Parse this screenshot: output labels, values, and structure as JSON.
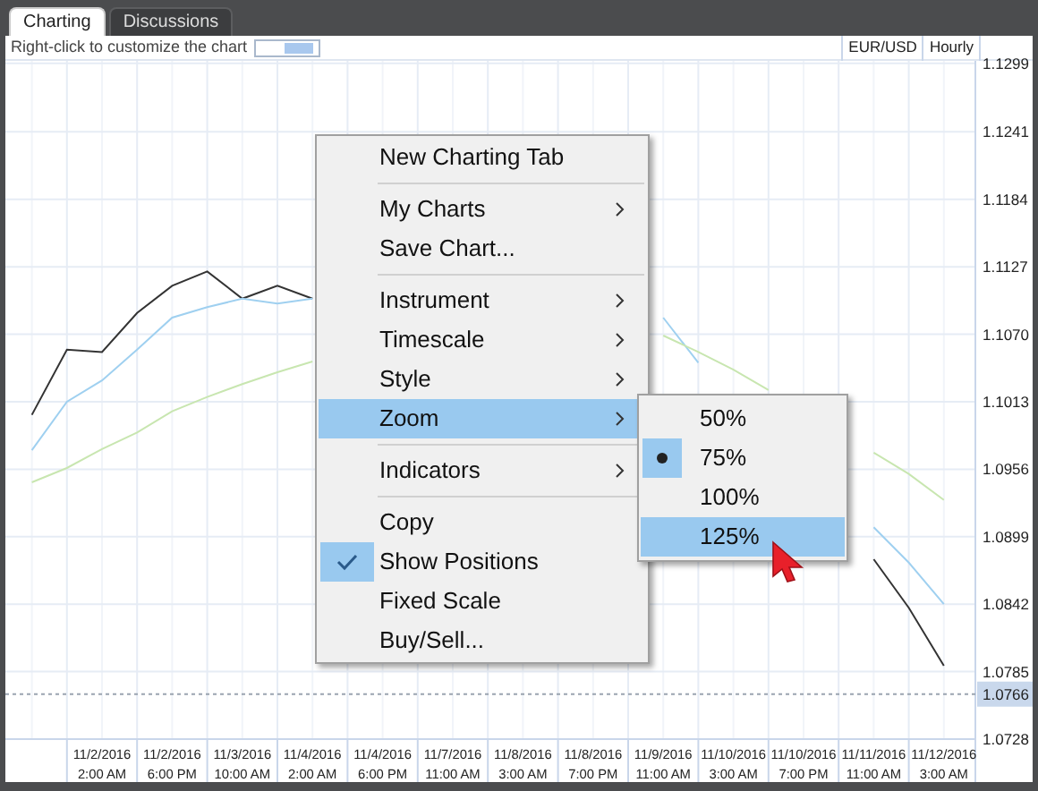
{
  "tabs": [
    {
      "label": "Charting",
      "selected": true
    },
    {
      "label": "Discussions",
      "selected": false
    }
  ],
  "toolbar": {
    "hint": "Right-click to customize the chart",
    "instrument": "EUR/USD",
    "timescale": "Hourly"
  },
  "chart": {
    "chart_data": {
      "type": "line",
      "grid": true,
      "categories": [
        null,
        null,
        "11/2/2016\n2:00 AM",
        null,
        "11/2/2016\n6:00 PM",
        null,
        "11/3/2016\n10:00 AM",
        null,
        "11/4/2016\n2:00 AM",
        null,
        "11/4/2016\n6:00 PM",
        null,
        "11/7/2016\n11:00 AM",
        null,
        "11/8/2016\n3:00 AM",
        null,
        "11/8/2016\n7:00 PM",
        null,
        "11/9/2016\n11:00 AM",
        null,
        "11/10/2016\n3:00 AM",
        null,
        "11/10/2016\n7:00 PM",
        null,
        "11/11/2016\n11:00 AM",
        null,
        "11/12/2016\n3:00 AM"
      ],
      "series": [
        {
          "color": "#333333",
          "values": [
            1.1002,
            1.1057,
            1.1055,
            1.1088,
            1.1111,
            1.1123,
            1.11,
            1.1111,
            1.11,
            null,
            null,
            null,
            null,
            null,
            null,
            null,
            null,
            null,
            null,
            null,
            null,
            null,
            null,
            null,
            1.088,
            1.0839,
            1.079
          ]
        },
        {
          "color": "#9fd0f0",
          "values": [
            1.0972,
            1.1013,
            1.1031,
            1.1057,
            1.1084,
            1.1093,
            1.11,
            1.1096,
            1.11,
            null,
            null,
            null,
            null,
            null,
            null,
            null,
            null,
            null,
            1.1084,
            1.1046,
            null,
            null,
            null,
            null,
            1.0907,
            1.0877,
            1.0842
          ]
        },
        {
          "color": "#c8e6b0",
          "values": [
            1.0945,
            1.0957,
            1.0973,
            1.0987,
            1.1005,
            1.1017,
            1.1028,
            1.1038,
            1.1047,
            null,
            null,
            null,
            null,
            null,
            null,
            null,
            null,
            null,
            1.1069,
            1.1055,
            1.104,
            1.1023,
            null,
            null,
            1.097,
            1.0952,
            1.093
          ]
        }
      ],
      "ylim": [
        1.0728,
        1.1301
      ],
      "yticks": [
        {
          "value": 1.1299,
          "label": "1.1299"
        },
        {
          "value": 1.1241,
          "label": "1.1241"
        },
        {
          "value": 1.1184,
          "label": "1.1184"
        },
        {
          "value": 1.1127,
          "label": "1.1127"
        },
        {
          "value": 1.107,
          "label": "1.1070"
        },
        {
          "value": 1.1013,
          "label": "1.1013"
        },
        {
          "value": 1.0956,
          "label": "1.0956"
        },
        {
          "value": 1.0899,
          "label": "1.0899"
        },
        {
          "value": 1.0842,
          "label": "1.0842"
        },
        {
          "value": 1.0785,
          "label": "1.0785"
        },
        {
          "value": 1.0728,
          "label": "1.0728"
        }
      ],
      "ref_lines": [
        {
          "axis": "y",
          "value": 1.0766,
          "label": "1.0766"
        }
      ]
    }
  },
  "context_menu": {
    "groups": [
      [
        {
          "label": "New Charting Tab",
          "submenu": false,
          "checked": false,
          "highlighted": false
        }
      ],
      [
        {
          "label": "My Charts",
          "submenu": true,
          "checked": false,
          "highlighted": false
        },
        {
          "label": "Save Chart...",
          "submenu": false,
          "checked": false,
          "highlighted": false
        }
      ],
      [
        {
          "label": "Instrument",
          "submenu": true,
          "checked": false,
          "highlighted": false
        },
        {
          "label": "Timescale",
          "submenu": true,
          "checked": false,
          "highlighted": false
        },
        {
          "label": "Style",
          "submenu": true,
          "checked": false,
          "highlighted": false
        },
        {
          "label": "Zoom",
          "submenu": true,
          "checked": false,
          "highlighted": true
        }
      ],
      [
        {
          "label": "Indicators",
          "submenu": true,
          "checked": false,
          "highlighted": false
        }
      ],
      [
        {
          "label": "Copy",
          "submenu": false,
          "checked": false,
          "highlighted": false
        },
        {
          "label": "Show Positions",
          "submenu": false,
          "checked": true,
          "highlighted": false
        },
        {
          "label": "Fixed Scale",
          "submenu": false,
          "checked": false,
          "highlighted": false
        },
        {
          "label": "Buy/Sell...",
          "submenu": false,
          "checked": false,
          "highlighted": false
        }
      ]
    ]
  },
  "zoom_submenu": {
    "items": [
      {
        "label": "50%",
        "selected": false,
        "highlighted": false
      },
      {
        "label": "75%",
        "selected": true,
        "highlighted": false
      },
      {
        "label": "100%",
        "selected": false,
        "highlighted": false
      },
      {
        "label": "125%",
        "selected": false,
        "highlighted": true
      }
    ]
  }
}
